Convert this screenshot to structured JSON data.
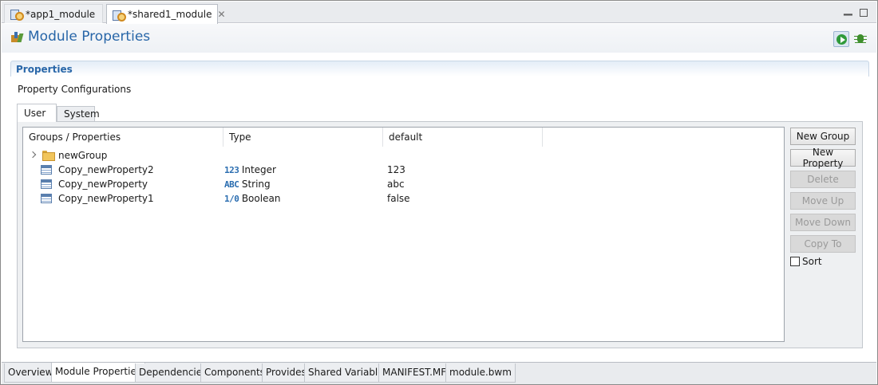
{
  "editor_tabs": [
    {
      "label": "*app1_module",
      "active": false
    },
    {
      "label": "*shared1_module",
      "active": true
    }
  ],
  "header": {
    "title": "Module Properties"
  },
  "section": {
    "title": "Properties",
    "subtitle": "Property Configurations"
  },
  "inner_tabs": [
    {
      "label": "User",
      "active": true
    },
    {
      "label": "System",
      "active": false
    }
  ],
  "tree": {
    "columns": [
      "Groups / Properties",
      "Type",
      "default"
    ],
    "rows": [
      {
        "kind": "group",
        "name": "newGroup",
        "type_icon": "",
        "type": "",
        "default": ""
      },
      {
        "kind": "property",
        "name": "Copy_newProperty2",
        "type_icon": "123",
        "type": "Integer",
        "default": "123"
      },
      {
        "kind": "property",
        "name": "Copy_newProperty",
        "type_icon": "ABC",
        "type": "String",
        "default": "abc"
      },
      {
        "kind": "property",
        "name": "Copy_newProperty1",
        "type_icon": "1/0",
        "type": "Boolean",
        "default": "false"
      }
    ]
  },
  "buttons": [
    {
      "label": "New Group",
      "enabled": true
    },
    {
      "label": "New Property",
      "enabled": true
    },
    {
      "label": "Delete",
      "enabled": false
    },
    {
      "label": "Move Up",
      "enabled": false
    },
    {
      "label": "Move Down",
      "enabled": false
    },
    {
      "label": "Copy To",
      "enabled": false
    }
  ],
  "sort": {
    "label": "Sort",
    "checked": false
  },
  "page_tabs": [
    {
      "label": "Overview",
      "active": false
    },
    {
      "label": "Module Properties",
      "active": true
    },
    {
      "label": "Dependencies",
      "active": false
    },
    {
      "label": "Components",
      "active": false
    },
    {
      "label": "Provides",
      "active": false
    },
    {
      "label": "Shared Variables",
      "active": false
    },
    {
      "label": "MANIFEST.MF",
      "active": false
    },
    {
      "label": "module.bwm",
      "active": false
    }
  ],
  "colors": {
    "title_blue": "#2866a8",
    "type_icon_blue": "#2a6db0",
    "run_green": "#2f9a3a"
  }
}
